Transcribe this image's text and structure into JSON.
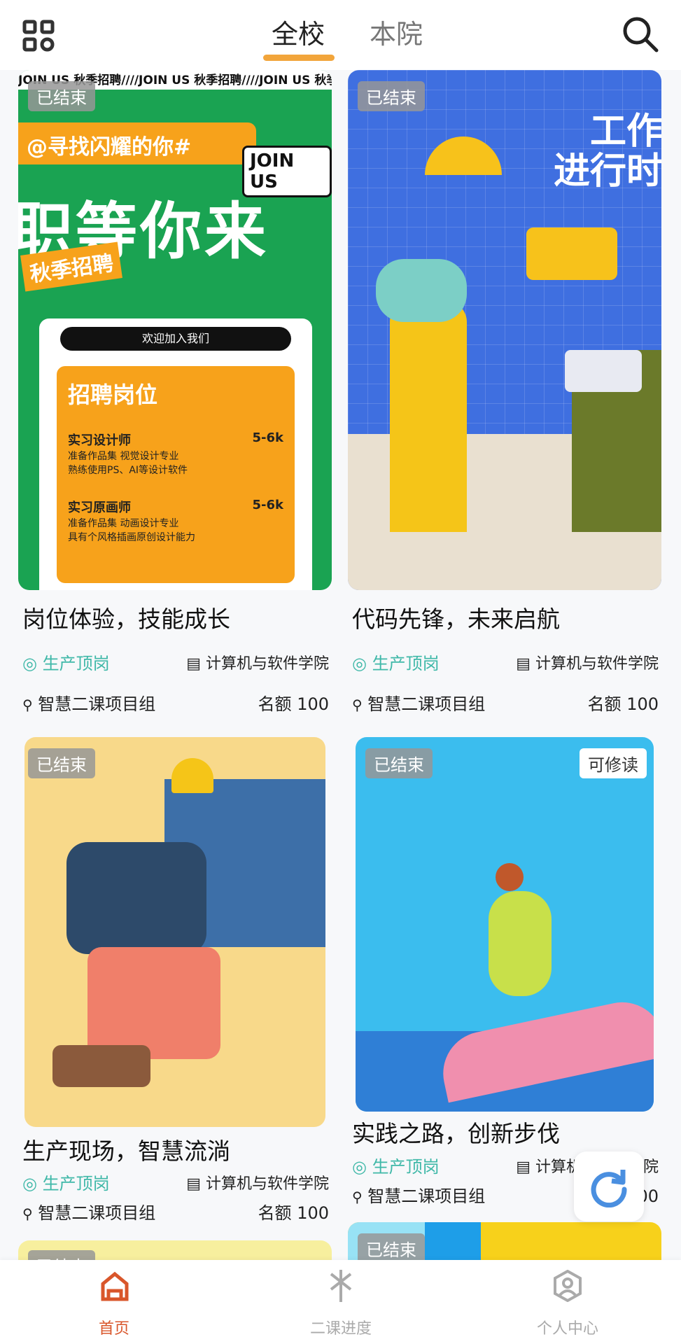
{
  "header": {
    "tabs": [
      {
        "label": "全校",
        "active": true
      },
      {
        "label": "本院",
        "active": false
      }
    ],
    "accent": "#f2a53b"
  },
  "cards": [
    {
      "status": "已结束",
      "title": "岗位体验，技能成长",
      "category": "生产顶岗",
      "college": "计算机与软件学院",
      "org": "智慧二课项目组",
      "quota": "名额 100",
      "poster": {
        "banner": "JOIN US 秋季招聘////JOIN US 秋季招聘////JOIN US 秋季招",
        "slogan": "@寻找闪耀的你#",
        "join": "JOIN US",
        "big": "职等你来",
        "season": "秋季招聘",
        "search": "欢迎加入我们",
        "section": "招聘岗位",
        "jobs": [
          {
            "name": "实习设计师",
            "salary": "5-6k",
            "desc1": "准备作品集 视觉设计专业",
            "desc2": "熟练使用PS、AI等设计软件"
          },
          {
            "name": "实习原画师",
            "salary": "5-6k",
            "desc1": "准备作品集 动画设计专业",
            "desc2": "具有个风格插画原创设计能力"
          }
        ]
      }
    },
    {
      "status": "已结束",
      "title": "代码先锋，未来启航",
      "category": "生产顶岗",
      "college": "计算机与软件学院",
      "org": "智慧二课项目组",
      "quota": "名额 100",
      "poster": {
        "headline1": "工作",
        "headline2": "进行时"
      }
    },
    {
      "status": "已结束",
      "title": "生产现场，智慧流淌",
      "category": "生产顶岗",
      "college": "计算机与软件学院",
      "org": "智慧二课项目组",
      "quota": "名额 100"
    },
    {
      "status": "已结束",
      "extra_badge": "可修读",
      "title": "实践之路，创新步伐",
      "category": "生产顶岗",
      "college": "计算机与软件学院",
      "org": "智慧二课项目组",
      "quota": "名额 100"
    },
    {
      "status": "已结束"
    },
    {
      "status": "已结束"
    }
  ],
  "nav": [
    {
      "label": "首页",
      "active": true
    },
    {
      "label": "二课进度",
      "active": false
    },
    {
      "label": "个人中心",
      "active": false
    }
  ],
  "colors": {
    "nav_active": "#d9562b",
    "nav_inactive": "#aaaaaa",
    "tag": "#3fb8a8"
  }
}
